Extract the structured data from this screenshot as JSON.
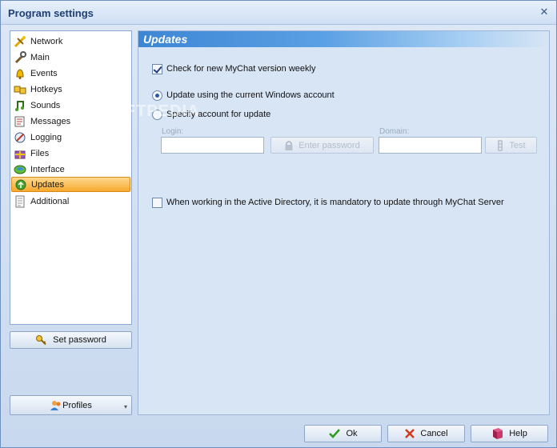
{
  "window": {
    "title": "Program settings",
    "close_glyph": "✕"
  },
  "sidebar": {
    "items": [
      {
        "label": "Network",
        "icon": "network-icon",
        "selected": false
      },
      {
        "label": "Main",
        "icon": "wrench-icon",
        "selected": false
      },
      {
        "label": "Events",
        "icon": "bell-icon",
        "selected": false
      },
      {
        "label": "Hotkeys",
        "icon": "keys-icon",
        "selected": false
      },
      {
        "label": "Sounds",
        "icon": "music-note-icon",
        "selected": false
      },
      {
        "label": "Messages",
        "icon": "messages-icon",
        "selected": false
      },
      {
        "label": "Logging",
        "icon": "logging-icon",
        "selected": false
      },
      {
        "label": "Files",
        "icon": "gift-box-icon",
        "selected": false
      },
      {
        "label": "Interface",
        "icon": "interface-icon",
        "selected": false
      },
      {
        "label": "Updates",
        "icon": "updates-icon",
        "selected": true
      },
      {
        "label": "Additional",
        "icon": "document-icon",
        "selected": false
      }
    ],
    "set_password_label": "Set password",
    "profiles_label": "Profiles"
  },
  "updates": {
    "header": "Updates",
    "check_weekly_label": "Check for new MyChat version weekly",
    "check_weekly_checked": true,
    "update_current_label": "Update using the current Windows account",
    "specify_account_label": "Specify account for update",
    "selected_account_option": "current",
    "login_label": "Login:",
    "login_value": "",
    "enter_password_label": "Enter password",
    "domain_label": "Domain:",
    "domain_value": "",
    "test_label": "Test",
    "active_directory_label": "When working in the Active Directory, it is mandatory to update through MyChat Server",
    "active_directory_checked": false
  },
  "footer": {
    "ok_label": "Ok",
    "cancel_label": "Cancel",
    "help_label": "Help"
  },
  "watermark": "SOFTPEDIA",
  "colors": {
    "accent": "#3d86d4",
    "selection": "#f7a92e",
    "panel": "#d8e5f5"
  }
}
